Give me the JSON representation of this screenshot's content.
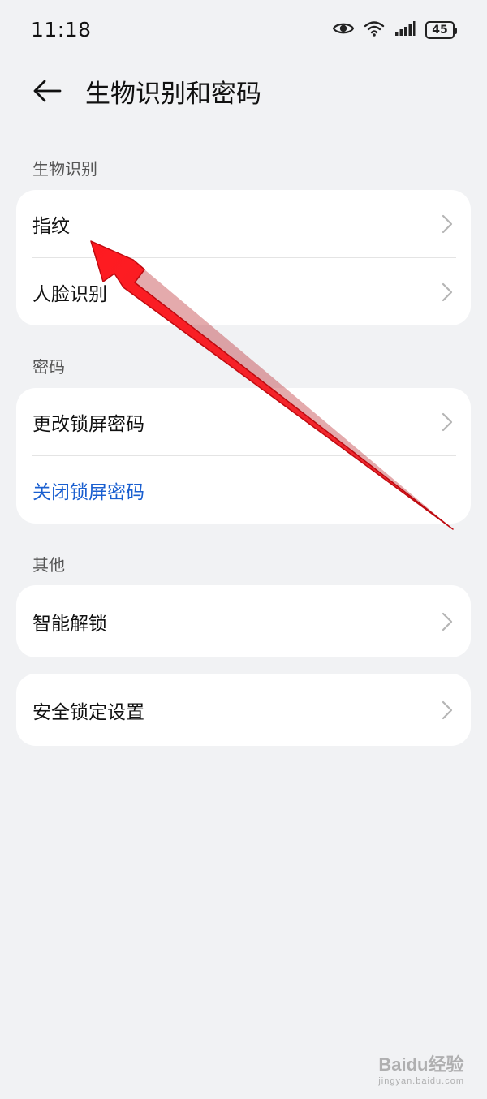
{
  "status_bar": {
    "time": "11:18",
    "battery": "45"
  },
  "header": {
    "title": "生物识别和密码"
  },
  "sections": {
    "biometric": {
      "label": "生物识别",
      "items": [
        "指纹",
        "人脸识别"
      ]
    },
    "password": {
      "label": "密码",
      "items": [
        "更改锁屏密码",
        "关闭锁屏密码"
      ]
    },
    "other": {
      "label": "其他",
      "items": [
        "智能解锁"
      ]
    },
    "security": {
      "items": [
        "安全锁定设置"
      ]
    }
  },
  "colors": {
    "background": "#f1f2f4",
    "card": "#ffffff",
    "accent_blue": "#1a5fd0",
    "annotation_red": "#e8141c"
  },
  "watermark": {
    "main": "Baidu经验",
    "sub": "jingyan.baidu.com"
  }
}
